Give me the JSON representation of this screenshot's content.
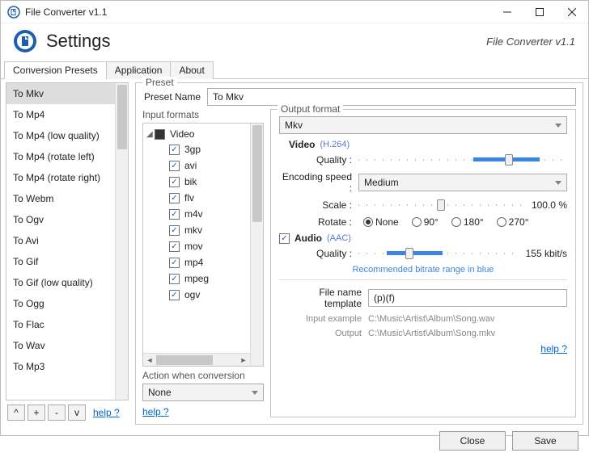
{
  "titlebar": {
    "title": "File Converter v1.1"
  },
  "header": {
    "page_title": "Settings",
    "app_version": "File Converter v1.1"
  },
  "tabs": [
    "Conversion Presets",
    "Application",
    "About"
  ],
  "active_tab": 0,
  "presets": [
    "To Mkv",
    "To Mp4",
    "To Mp4 (low quality)",
    "To Mp4 (rotate left)",
    "To Mp4 (rotate right)",
    "To Webm",
    "To Ogv",
    "To Avi",
    "To Gif",
    "To Gif (low quality)",
    "To Ogg",
    "To Flac",
    "To Wav",
    "To Mp3"
  ],
  "selected_preset": 0,
  "left_buttons": [
    "^",
    "+",
    "-",
    "v"
  ],
  "left_help": "help ?",
  "preset_group": {
    "legend": "Preset",
    "name_label": "Preset Name",
    "name_value": "To Mkv"
  },
  "input_formats": {
    "legend": "Input formats",
    "root": "Video",
    "items": [
      "3gp",
      "avi",
      "bik",
      "flv",
      "m4v",
      "mkv",
      "mov",
      "mp4",
      "mpeg",
      "ogv"
    ]
  },
  "action_conv": {
    "label": "Action when conversion",
    "value": "None",
    "help": "help ?"
  },
  "output": {
    "legend": "Output format",
    "format": "Mkv",
    "video": {
      "title": "Video",
      "codec": "(H.264)",
      "quality_label": "Quality :",
      "encoding_label": "Encoding speed :",
      "encoding_value": "Medium",
      "scale_label": "Scale :",
      "scale_value": "100.0 %",
      "rotate_label": "Rotate :",
      "rotate_options": [
        "None",
        "90°",
        "180°",
        "270°"
      ],
      "rotate_selected": 0
    },
    "audio": {
      "title": "Audio",
      "codec": "(AAC)",
      "enabled": true,
      "quality_label": "Quality :",
      "bitrate": "155 kbit/s",
      "hint": "Recommended bitrate range in blue"
    },
    "file_template": {
      "label": "File name template",
      "value": "(p)(f)",
      "input_example_label": "Input example",
      "input_example": "C:\\Music\\Artist\\Album\\Song.wav",
      "output_label": "Output",
      "output_value": "C:\\Music\\Artist\\Album\\Song.mkv",
      "help": "help ?"
    }
  },
  "footer": {
    "close": "Close",
    "save": "Save"
  }
}
